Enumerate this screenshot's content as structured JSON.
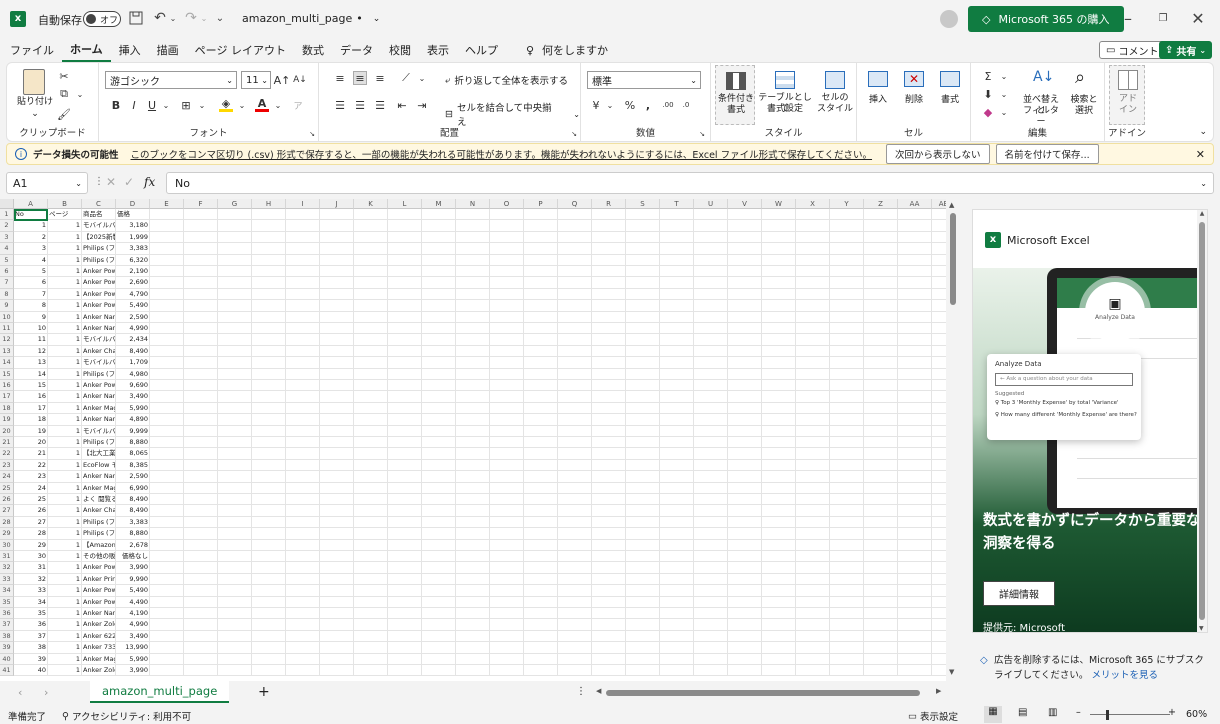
{
  "title_bar": {
    "autosave_label": "自動保存",
    "autosave_state": "オフ",
    "filename": "amazon_multi_page",
    "saved_marker": "•",
    "buy_button": "Microsoft 365 の購入"
  },
  "menu": {
    "items": [
      "ファイル",
      "ホーム",
      "挿入",
      "描画",
      "ページ レイアウト",
      "数式",
      "データ",
      "校閲",
      "表示",
      "ヘルプ"
    ],
    "active": "ホーム",
    "tell_me": "何をしますか",
    "comment": "コメント",
    "share": "共有"
  },
  "ribbon": {
    "clipboard": {
      "label": "クリップボード",
      "paste": "貼り付け"
    },
    "font": {
      "label": "フォント",
      "name": "游ゴシック",
      "size": "11",
      "bold": "B",
      "italic": "I",
      "underline": "U"
    },
    "alignment": {
      "label": "配置",
      "wrap": "折り返して全体を表示する",
      "merge": "セルを結合して中央揃え"
    },
    "number": {
      "label": "数値",
      "format": "標準"
    },
    "styles": {
      "label": "スタイル",
      "conditional_1": "条件付き",
      "conditional_2": "書式",
      "table_1": "テーブルとして",
      "table_2": "書式設定",
      "cell_1": "セルの",
      "cell_2": "スタイル"
    },
    "cells": {
      "label": "セル",
      "insert": "挿入",
      "delete": "削除",
      "format": "書式"
    },
    "editing": {
      "label": "編集",
      "sort_1": "並べ替えと",
      "sort_2": "フィルター",
      "find_1": "検索と",
      "find_2": "選択"
    },
    "addin": {
      "label": "アドイン",
      "name_1": "アド",
      "name_2": "イン"
    }
  },
  "warning": {
    "title": "データ損失の可能性",
    "message": "このブックをコンマ区切り (.csv) 形式で保存すると、一部の機能が失われる可能性があります。機能が失われないようにするには、Excel ファイル形式で保存してください。",
    "dont_show": "次回から表示しない",
    "save_as": "名前を付けて保存..."
  },
  "formula_bar": {
    "name_box": "A1",
    "fx": "fx",
    "value": "No"
  },
  "grid": {
    "columns": [
      "A",
      "B",
      "C",
      "D",
      "E",
      "F",
      "G",
      "H",
      "I",
      "J",
      "K",
      "L",
      "M",
      "N",
      "O",
      "P",
      "Q",
      "R",
      "S",
      "T",
      "U",
      "V",
      "W",
      "X",
      "Y",
      "Z",
      "AA",
      "AB"
    ],
    "headers": [
      "No",
      "ページ",
      "商品名",
      "価格"
    ],
    "rows": [
      [
        "1",
        "1",
        "モバイルバ",
        "3,180"
      ],
      [
        "2",
        "1",
        "【2025新製",
        "1,999"
      ],
      [
        "3",
        "1",
        "Philips (フ",
        "3,383"
      ],
      [
        "4",
        "1",
        "Philips (フ",
        "6,320"
      ],
      [
        "5",
        "1",
        "Anker Pow",
        "2,190"
      ],
      [
        "6",
        "1",
        "Anker Pow",
        "2,690"
      ],
      [
        "7",
        "1",
        "Anker Pow",
        "4,790"
      ],
      [
        "8",
        "1",
        "Anker Pow",
        "5,490"
      ],
      [
        "9",
        "1",
        "Anker Nar",
        "2,590"
      ],
      [
        "10",
        "1",
        "Anker Nar",
        "4,990"
      ],
      [
        "11",
        "1",
        "モバイルバ",
        "2,434"
      ],
      [
        "12",
        "1",
        "Anker Cha",
        "8,490"
      ],
      [
        "13",
        "1",
        "モバイルバ",
        "1,709"
      ],
      [
        "14",
        "1",
        "Philips (フ",
        "4,980"
      ],
      [
        "15",
        "1",
        "Anker Pow",
        "9,690"
      ],
      [
        "16",
        "1",
        "Anker Nar",
        "3,490"
      ],
      [
        "17",
        "1",
        "Anker Mag",
        "5,990"
      ],
      [
        "18",
        "1",
        "Anker Nar",
        "4,890"
      ],
      [
        "19",
        "1",
        "モバイルバ",
        "9,999"
      ],
      [
        "20",
        "1",
        "Philips (フ",
        "8,880"
      ],
      [
        "21",
        "1",
        "【北大工業",
        "8,065"
      ],
      [
        "22",
        "1",
        "EcoFlow モ",
        "8,385"
      ],
      [
        "23",
        "1",
        "Anker Nar",
        "2,590"
      ],
      [
        "24",
        "1",
        "Anker Mag",
        "6,990"
      ],
      [
        "25",
        "1",
        "よく 閲覧る",
        "8,490"
      ],
      [
        "26",
        "1",
        "Anker Cha",
        "8,490"
      ],
      [
        "27",
        "1",
        "Philips (フ",
        "3,383"
      ],
      [
        "28",
        "1",
        "Philips (フ",
        "8,880"
      ],
      [
        "29",
        "1",
        "【Amazon",
        "2,678"
      ],
      [
        "30",
        "1",
        "その他の販",
        "価格なし"
      ],
      [
        "31",
        "1",
        "Anker Pow",
        "3,990"
      ],
      [
        "32",
        "1",
        "Anker Prin",
        "9,990"
      ],
      [
        "33",
        "1",
        "Anker Pow",
        "5,490"
      ],
      [
        "34",
        "1",
        "Anker Pow",
        "4,490"
      ],
      [
        "35",
        "1",
        "Anker Nar",
        "4,190"
      ],
      [
        "36",
        "1",
        "Anker Zolo",
        "4,990"
      ],
      [
        "37",
        "1",
        "Anker 622",
        "3,490"
      ],
      [
        "38",
        "1",
        "Anker 733",
        "13,990"
      ],
      [
        "39",
        "1",
        "Anker Mag",
        "5,990"
      ],
      [
        "40",
        "1",
        "Anker Zolo",
        "3,990"
      ]
    ]
  },
  "side_pane": {
    "brand": "Microsoft Excel",
    "analyze_icon": "Analyze Data",
    "card_title": "Analyze Data",
    "card_input": "Ask a question about your data",
    "card_suggested": "Suggested",
    "suggestion_1": "Top 3 'Monthly Expense' by total 'Variance'",
    "suggestion_2": "How many different 'Monthly Expense' are there?",
    "headline": "数式を書かずにデータから重要な洞察を得る",
    "details_button": "詳細情報",
    "provider": "提供元: Microsoft",
    "ad_notice": "広告を削除するには、Microsoft 365 にサブスクライブしてください。",
    "ad_link": "メリットを見る"
  },
  "sheets": {
    "active": "amazon_multi_page"
  },
  "status": {
    "ready": "準備完了",
    "accessibility": "アクセシビリティ: 利用不可",
    "display_settings": "表示設定",
    "zoom": "60%"
  },
  "colors": {
    "accent": "#107c41",
    "link": "#1a5fb4"
  }
}
